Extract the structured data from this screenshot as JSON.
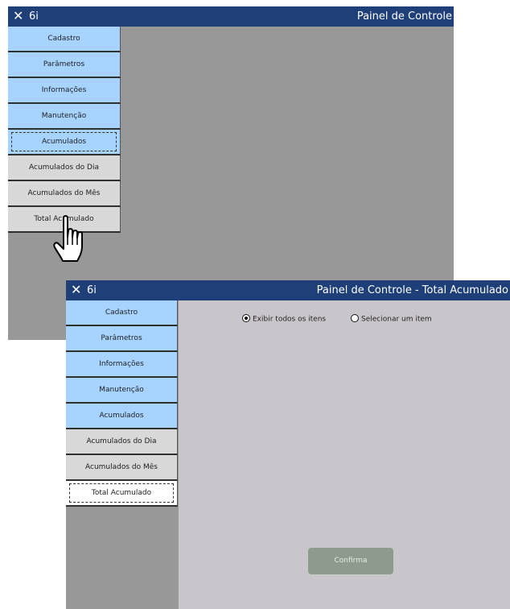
{
  "window1": {
    "app_name": "6i",
    "title": "Painel de Controle",
    "menu": [
      {
        "label": "Cadastro",
        "style": "blue"
      },
      {
        "label": "Parâmetros",
        "style": "blue"
      },
      {
        "label": "Informações",
        "style": "blue"
      },
      {
        "label": "Manutenção",
        "style": "blue"
      },
      {
        "label": "Acumulados",
        "style": "blue-focused"
      },
      {
        "label": "Acumulados do Dia",
        "style": "gray"
      },
      {
        "label": "Acumulados do Mês",
        "style": "gray"
      },
      {
        "label": "Total Acumulado",
        "style": "gray"
      }
    ]
  },
  "window2": {
    "app_name": "6i",
    "title": "Painel de Controle - Total Acumulado",
    "menu": [
      {
        "label": "Cadastro",
        "style": "blue"
      },
      {
        "label": "Parâmetros",
        "style": "blue"
      },
      {
        "label": "Informações",
        "style": "blue"
      },
      {
        "label": "Manutenção",
        "style": "blue"
      },
      {
        "label": "Acumulados",
        "style": "blue"
      },
      {
        "label": "Acumulados do Dia",
        "style": "gray"
      },
      {
        "label": "Acumulados do Mês",
        "style": "gray"
      },
      {
        "label": "Total Acumulado",
        "style": "white-selected"
      }
    ],
    "options": {
      "show_all": {
        "label": "Exibir todos os itens",
        "checked": true
      },
      "select_one": {
        "label": "Selecionar um item",
        "checked": false
      }
    },
    "confirm_label": "Confirma"
  },
  "colors": {
    "titlebar": "#1e3f78",
    "menu_blue": "#a6d3ff",
    "menu_gray": "#d8d8d8",
    "window_bg": "#999899",
    "content_bg": "#c8c6ca",
    "confirm_button": "#8e9a8d"
  },
  "icons": {
    "close": "close-icon",
    "cursor": "hand-pointer-icon"
  }
}
